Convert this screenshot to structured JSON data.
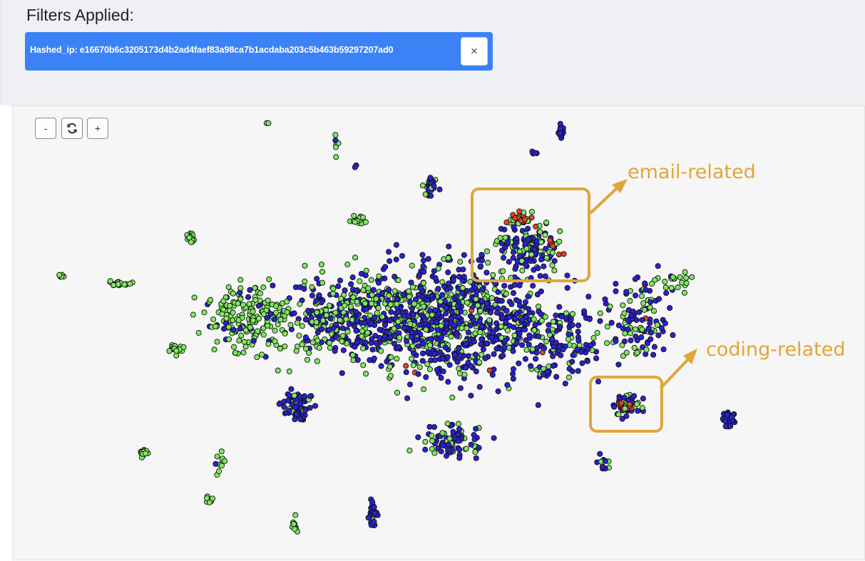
{
  "filters": {
    "title": "Filters Applied:",
    "chip_label": "Hashed_ip: e16670b6c3205173d4b2ad4faef83a98ca7b1acdaba203c5b463b59297207ad0",
    "remove_icon": "×"
  },
  "toolbar": {
    "zoom_out_label": "-",
    "reset_icon": "refresh-icon",
    "zoom_in_label": "+"
  },
  "colors": {
    "green": "#7ee860",
    "blue": "#2a22d0",
    "red": "#e0432a",
    "annotation": "#e0a63b"
  },
  "annotations": {
    "email": "email-related",
    "coding": "coding-related"
  }
}
